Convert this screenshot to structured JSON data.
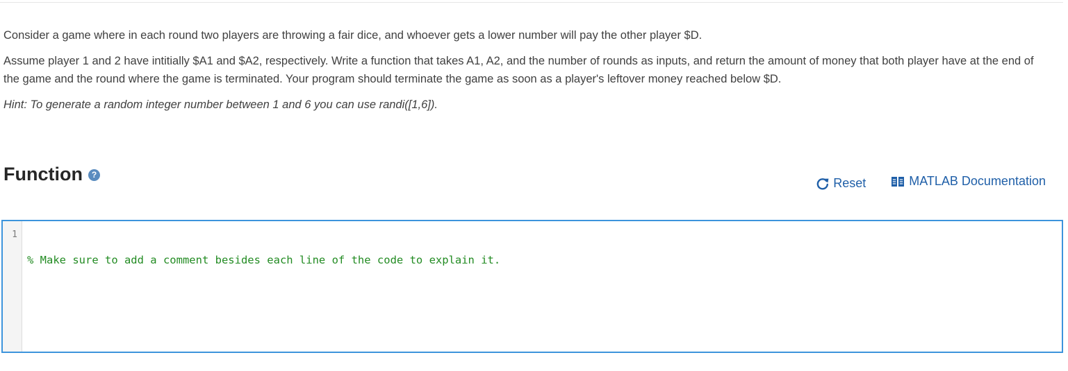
{
  "problem": {
    "paragraph1": "Consider a game where in each round two players are throwing a fair dice, and whoever gets a lower number will pay the other player $D.",
    "paragraph2": "Assume player 1 and 2 have intitially $A1 and $A2, respectively. Write a function that takes A1, A2, and the number of rounds as inputs, and return the amount of money that both player have at the end of the game and the round where the game is terminated. Your program should terminate the game as soon as a player's leftover money reached below $D.",
    "hint": "Hint: To generate a random integer number between 1 and 6 you can use randi([1,6])."
  },
  "section": {
    "title": "Function",
    "help_icon": "question-circle-icon",
    "help_glyph": "?"
  },
  "toolbar": {
    "reset_label": "Reset",
    "reset_icon": "refresh-icon",
    "doc_label": "MATLAB Documentation",
    "doc_icon": "book-icon"
  },
  "editor": {
    "lines": [
      {
        "number": "1",
        "text": "% Make sure to add a comment besides each line of the code to explain it."
      }
    ],
    "border_color": "#3c94dc",
    "comment_color": "#228b22"
  },
  "colors": {
    "link": "#1f5fa8",
    "help_icon_bg": "#5a8cbf"
  }
}
